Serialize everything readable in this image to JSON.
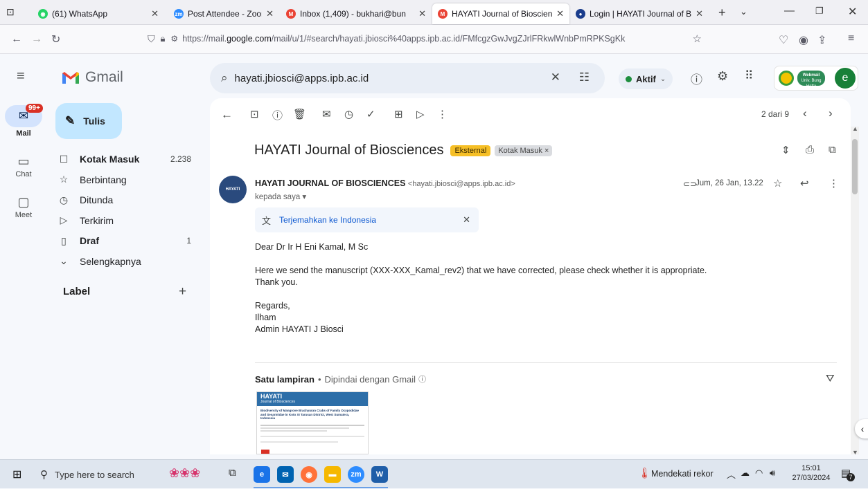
{
  "browser": {
    "tabs": [
      {
        "label": "(61) WhatsApp",
        "icon": "whatsapp-icon",
        "color": "#25d366",
        "glyph": "◉"
      },
      {
        "label": "Post Attendee - Zoom",
        "icon": "zoom-icon",
        "color": "#2d8cff",
        "glyph": "zm"
      },
      {
        "label": "Inbox (1,409) - bukhari@bun",
        "icon": "gmail-icon",
        "color": "#ea4335",
        "glyph": "M"
      },
      {
        "label": "HAYATI Journal of Bioscience",
        "icon": "gmail-icon",
        "color": "#ea4335",
        "glyph": "M"
      },
      {
        "label": "Login | HAYATI Journal of Bio",
        "icon": "journal-icon",
        "color": "#1a3c8c",
        "glyph": "●"
      }
    ],
    "url_prefix": "https://mail.",
    "url_domain": "google.com",
    "url_suffix": "/mail/u/1/#search/hayati.jbiosci%40apps.ipb.ac.id/FMfcgzGwJvgZJrlFRkwlWnbPmRPKSgKk"
  },
  "gmail": {
    "logo_text": "Gmail",
    "search_value": "hayati.jbiosci@apps.ipb.ac.id",
    "status_label": "Aktif",
    "status_color": "#1e8e3e",
    "avatar_letter": "e",
    "org_badge_top": "Webmail",
    "org_badge_bottom": "Univ. Bung Hatta",
    "compose_label": "Tulis",
    "rail": {
      "mail_label": "Mail",
      "mail_badge": "99+",
      "chat_label": "Chat",
      "meet_label": "Meet"
    },
    "nav": [
      {
        "label": "Kotak Masuk",
        "count": "2.238",
        "icon": "inbox-icon",
        "glyph": "☐",
        "bold": true
      },
      {
        "label": "Berbintang",
        "count": "",
        "icon": "star-icon",
        "glyph": "☆",
        "bold": false
      },
      {
        "label": "Ditunda",
        "count": "",
        "icon": "clock-icon",
        "glyph": "◷",
        "bold": false
      },
      {
        "label": "Terkirim",
        "count": "",
        "icon": "send-icon",
        "glyph": "▷",
        "bold": false
      },
      {
        "label": "Draf",
        "count": "1",
        "icon": "draft-icon",
        "glyph": "▯",
        "bold": true
      },
      {
        "label": "Selengkapnya",
        "count": "",
        "icon": "chevron-down-icon",
        "glyph": "⌄",
        "bold": false
      }
    ],
    "labels_heading": "Label",
    "pager": "2 dari 9"
  },
  "email": {
    "subject": "HAYATI Journal of Biosciences",
    "tag_external": "Eksternal",
    "tag_inbox": "Kotak Masuk ×",
    "sender_name": "HAYATI JOURNAL OF BIOSCIENCES",
    "sender_email": "<hayati.jbiosci@apps.ipb.ac.id>",
    "to_line": "kepada saya ▾",
    "date": "Jum, 26 Jan, 13.22",
    "translate_label": "Terjemahkan ke Indonesia",
    "body": [
      "Dear Dr Ir H Eni Kamal, M Sc",
      "",
      "Here we send the manuscript (XXX-XXX_Kamal_rev2) that we have corrected, please check whether it is appropriate.",
      "Thank you.",
      "",
      "Regards,",
      "Ilham",
      "Admin HAYATI J Biosci"
    ],
    "attachments_heading": "Satu lampiran",
    "attachments_scan": "Dipindai dengan Gmail",
    "attachment_thumb_title": "HAYATI",
    "attachment_thumb_subtitle": "Journal of Biosciences",
    "attachment_thumb_article": "Biodiversity of Mangrove Brachyuran Crabs of Family Ocypodidae and Sesarmidae in Koto XI Tarusan District, West Sumatera, Indonesia"
  },
  "taskbar": {
    "search_placeholder": "Type here to search",
    "weather_text": "Mendekati rekor",
    "time": "15:01",
    "date": "27/03/2024",
    "notification_count": "7"
  }
}
